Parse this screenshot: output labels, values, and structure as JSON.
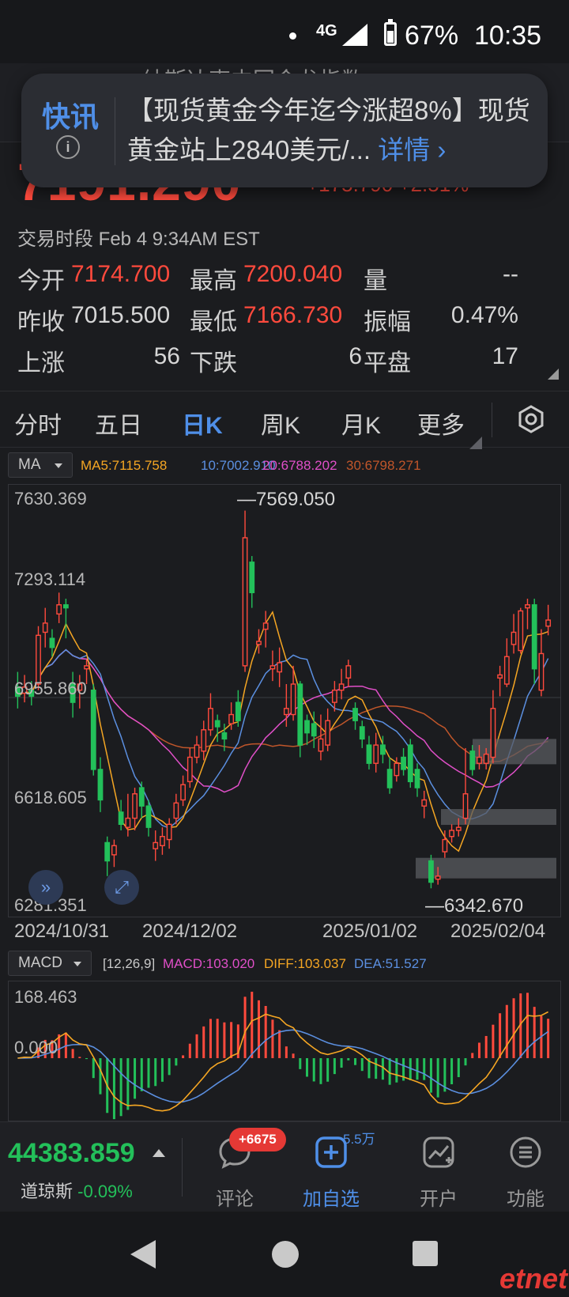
{
  "status": {
    "network": "4G",
    "battery": "67%",
    "time": "10:35"
  },
  "header": {
    "title": "纳斯达克中国金龙指数",
    "price": "7191.290",
    "change": "+175.790 +2.51%"
  },
  "toast": {
    "label": "快讯",
    "text": "【现货黄金今年迄今涨超8%】现货黄金站上2840美元/...",
    "link": "详情 ›"
  },
  "session": "交易时段 Feb 4 9:34AM EST",
  "stats": {
    "open_label": "今开",
    "open": "7174.700",
    "high_label": "最高",
    "high": "7200.040",
    "vol_label": "量",
    "vol": "--",
    "prev_label": "昨收",
    "prev": "7015.500",
    "low_label": "最低",
    "low": "7166.730",
    "amp_label": "振幅",
    "amp": "0.47%",
    "up_label": "上涨",
    "up": "56",
    "down_label": "下跌",
    "down": "6",
    "flat_label": "平盘",
    "flat": "17"
  },
  "tabs": [
    "分时",
    "五日",
    "日K",
    "周K",
    "月K",
    "更多"
  ],
  "active_tab": "日K",
  "ma": {
    "select": "MA",
    "ma5": "MA5:7115.758",
    "ma10": "10:7002.910",
    "ma20": "20:6788.202",
    "ma30": "30:6798.271",
    "colors": {
      "ma5": "#f5a623",
      "ma10": "#5b8fe0",
      "ma20": "#e04fc8",
      "ma30": "#c0562a"
    }
  },
  "chart_data": [
    {
      "type": "candlestick",
      "y_labels": [
        "7630.369",
        "7293.114",
        "6955.860",
        "6618.605",
        "6281.351"
      ],
      "ylim": [
        6281.351,
        7630.369
      ],
      "x_labels": [
        "2024/10/31",
        "2024/12/02",
        "2025/01/02",
        "2025/02/04"
      ],
      "high_annotation": "7569.050",
      "low_annotation": "6342.670",
      "colors": {
        "up": "#ff4a3d",
        "down": "#23c05a"
      },
      "candles": [
        [
          6990,
          6960,
          7040,
          6920
        ],
        [
          6970,
          6990,
          7030,
          6940
        ],
        [
          6980,
          6960,
          7010,
          6930
        ],
        [
          7000,
          7160,
          7190,
          6980
        ],
        [
          7170,
          7200,
          7250,
          7120
        ],
        [
          7150,
          7120,
          7180,
          7090
        ],
        [
          7230,
          7260,
          7300,
          7200
        ],
        [
          7260,
          7250,
          7280,
          7150
        ],
        [
          7000,
          6940,
          7040,
          6890
        ],
        [
          6980,
          7000,
          7030,
          6920
        ],
        [
          7050,
          7060,
          7080,
          7000
        ],
        [
          6980,
          6720,
          7000,
          6700
        ],
        [
          6720,
          6620,
          6760,
          6580
        ],
        [
          6480,
          6420,
          6500,
          6370
        ],
        [
          6440,
          6470,
          6490,
          6400
        ],
        [
          6580,
          6540,
          6620,
          6520
        ],
        [
          6530,
          6560,
          6640,
          6500
        ],
        [
          6560,
          6640,
          6660,
          6520
        ],
        [
          6660,
          6600,
          6680,
          6560
        ],
        [
          6600,
          6530,
          6620,
          6500
        ],
        [
          6460,
          6480,
          6520,
          6420
        ],
        [
          6470,
          6500,
          6530,
          6440
        ],
        [
          6490,
          6540,
          6560,
          6460
        ],
        [
          6560,
          6610,
          6640,
          6540
        ],
        [
          6620,
          6670,
          6700,
          6600
        ],
        [
          6680,
          6760,
          6790,
          6660
        ],
        [
          6760,
          6800,
          6830,
          6740
        ],
        [
          6780,
          6850,
          6880,
          6750
        ],
        [
          6850,
          6920,
          6970,
          6830
        ],
        [
          6880,
          6860,
          6900,
          6810
        ],
        [
          6840,
          6820,
          6870,
          6780
        ],
        [
          6870,
          6900,
          6940,
          6850
        ],
        [
          6940,
          6880,
          6980,
          6860
        ],
        [
          7060,
          7480,
          7569,
          7040
        ],
        [
          7400,
          7300,
          7420,
          7250
        ],
        [
          7130,
          7140,
          7180,
          7100
        ],
        [
          7180,
          7200,
          7240,
          7120
        ],
        [
          7050,
          7060,
          7110,
          7010
        ],
        [
          7040,
          7070,
          7120,
          6990
        ],
        [
          6900,
          6920,
          7000,
          6860
        ],
        [
          6900,
          7000,
          7060,
          6880
        ],
        [
          7000,
          6800,
          7010,
          6760
        ],
        [
          6880,
          6840,
          6900,
          6800
        ],
        [
          6870,
          6830,
          6910,
          6790
        ],
        [
          6780,
          6820,
          6900,
          6750
        ],
        [
          6800,
          6880,
          6920,
          6780
        ],
        [
          6940,
          6980,
          7010,
          6910
        ],
        [
          6980,
          7000,
          7050,
          6950
        ],
        [
          7020,
          7060,
          7080,
          6990
        ],
        [
          6920,
          6880,
          6940,
          6850
        ],
        [
          6860,
          6820,
          6880,
          6790
        ],
        [
          6800,
          6740,
          6830,
          6720
        ],
        [
          6740,
          6800,
          6840,
          6710
        ],
        [
          6800,
          6770,
          6830,
          6740
        ],
        [
          6720,
          6660,
          6760,
          6640
        ],
        [
          6700,
          6740,
          6760,
          6680
        ],
        [
          6760,
          6720,
          6790,
          6700
        ],
        [
          6800,
          6680,
          6820,
          6660
        ],
        [
          6720,
          6660,
          6740,
          6630
        ],
        [
          6600,
          6620,
          6650,
          6560
        ],
        [
          6420,
          6350,
          6440,
          6330
        ],
        [
          6360,
          6370,
          6400,
          6342
        ],
        [
          6450,
          6490,
          6520,
          6430
        ],
        [
          6500,
          6520,
          6540,
          6480
        ],
        [
          6520,
          6530,
          6560,
          6500
        ],
        [
          6560,
          6640,
          6790,
          6540
        ],
        [
          6780,
          6720,
          6800,
          6700
        ],
        [
          6740,
          6760,
          6800,
          6720
        ],
        [
          6740,
          6770,
          6790,
          6720
        ],
        [
          6760,
          6920,
          6980,
          6740
        ],
        [
          7020,
          7030,
          7060,
          6960
        ],
        [
          7000,
          7090,
          7150,
          6990
        ],
        [
          7130,
          7170,
          7230,
          7100
        ],
        [
          7110,
          7240,
          7250,
          7100
        ],
        [
          7250,
          7260,
          7280,
          7180
        ],
        [
          7260,
          7050,
          7280,
          7000
        ],
        [
          6980,
          7100,
          7180,
          6960
        ],
        [
          7190,
          7210,
          7260,
          7160
        ]
      ]
    },
    {
      "type": "bar",
      "name": "MACD",
      "y_labels": [
        "168.463",
        "0.000"
      ],
      "params": "[12,26,9]",
      "macd": "MACD:103.020",
      "diff": "DIFF:103.037",
      "dea": "DEA:51.527",
      "colors": {
        "macd": "#e04fc8",
        "diff": "#f5a623",
        "dea": "#5b8fe0"
      }
    }
  ],
  "macd_select": "MACD",
  "bottom": {
    "dji_value": "44383.859",
    "dji_name": "道琼斯",
    "dji_change": "-0.09%",
    "comment_badge": "+6675",
    "comment": "评论",
    "watch_count": "5.5万",
    "watch": "加自选",
    "account": "开户",
    "func": "功能"
  },
  "watermark": "etnet"
}
